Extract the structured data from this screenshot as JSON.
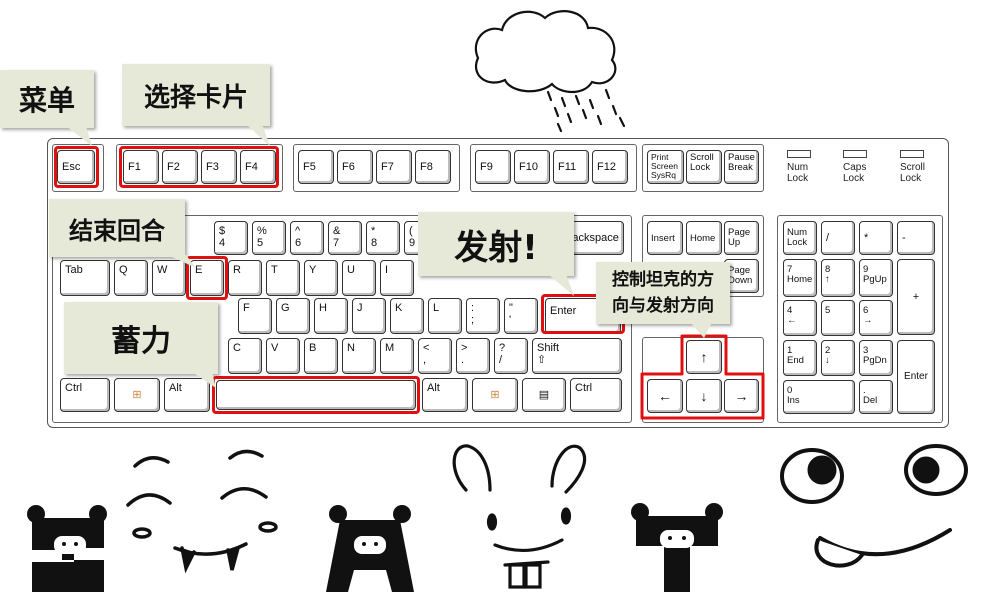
{
  "keyboard": {
    "leds": [
      {
        "label": "Num\nLock"
      },
      {
        "label": "Caps\nLock"
      },
      {
        "label": "Scroll\nLock"
      }
    ],
    "fn_row": [
      "Esc",
      "F1",
      "F2",
      "F3",
      "F4",
      "F5",
      "F6",
      "F7",
      "F8",
      "F9",
      "F10",
      "F11",
      "F12"
    ],
    "sys_keys": [
      "Print\nScreen\nSysRq",
      "Scroll\nLock",
      "Pause\nBreak"
    ],
    "num_row": [
      "$\n4",
      "%\n5",
      "^\n6",
      "&\n7",
      "*\n8",
      "(\n9",
      "Backspace"
    ],
    "q_row": [
      "Tab",
      "Q",
      "W",
      "E",
      "R",
      "T",
      "Y",
      "U",
      "I"
    ],
    "a_row": [
      "F",
      "G",
      "H",
      "J",
      "K",
      "L",
      ":\n;",
      "\"\n'",
      "Enter"
    ],
    "z_row": [
      "C",
      "V",
      "B",
      "N",
      "M",
      "<\n,",
      ">\n.",
      "?\n/",
      "Shift\n⇧"
    ],
    "bottom_row": [
      "Ctrl",
      "⊞",
      "Alt",
      "",
      "Alt",
      "⊞",
      "▤",
      "Ctrl"
    ],
    "nav": [
      "Insert",
      "Home",
      "Page\nUp",
      "Page\nDown"
    ],
    "arrows": {
      "up": "↑",
      "left": "←",
      "down": "↓",
      "right": "→"
    },
    "numpad": [
      "Num\nLock",
      "/",
      "*",
      "-",
      "7\nHome",
      "8\n↑",
      "9\nPgUp",
      "+",
      "4\n←",
      "5",
      "6\n→",
      "1\nEnd",
      "2\n↓",
      "3\nPgDn",
      "Enter",
      "0\nIns",
      ".\nDel"
    ]
  },
  "callouts": {
    "menu": "菜单",
    "select_card": "选择卡片",
    "end_turn": "结束回合",
    "fire": "发射!",
    "aim": "控制坦克的方\n向与发射方向",
    "charge": "蓄力"
  },
  "colors": {
    "highlight": "#e01010",
    "note_bg": "#e6e8d8"
  }
}
